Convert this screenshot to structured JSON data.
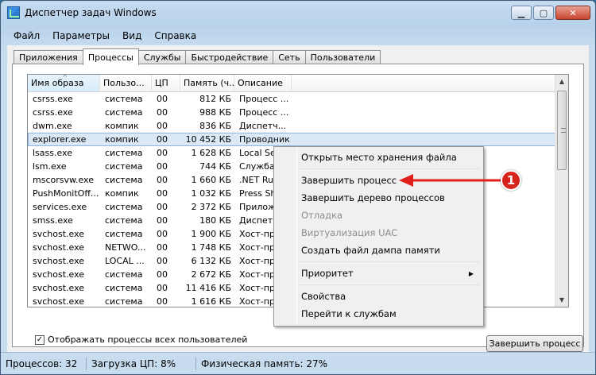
{
  "window": {
    "title": "Диспетчер задач Windows"
  },
  "menu": [
    "Файл",
    "Параметры",
    "Вид",
    "Справка"
  ],
  "tabs": [
    "Приложения",
    "Процессы",
    "Службы",
    "Быстродействие",
    "Сеть",
    "Пользователи"
  ],
  "active_tab": "Процессы",
  "columns": [
    "Имя образа",
    "Пользо...",
    "ЦП",
    "Память (ч...",
    "Описание"
  ],
  "rows": [
    [
      "csrss.exe",
      "система",
      "00",
      "812 КБ",
      "Процесс ..."
    ],
    [
      "csrss.exe",
      "система",
      "00",
      "988 КБ",
      "Процесс ..."
    ],
    [
      "dwm.exe",
      "компик",
      "00",
      "836 КБ",
      "Диспетч..."
    ],
    [
      "explorer.exe",
      "компик",
      "00",
      "10 452 КБ",
      "Проводник"
    ],
    [
      "lsass.exe",
      "система",
      "00",
      "1 628 КБ",
      "Local Sec..."
    ],
    [
      "lsm.exe",
      "система",
      "00",
      "744 КБ",
      "Служба ..."
    ],
    [
      "mscorsvw.exe",
      "система",
      "00",
      "1 660 КБ",
      ".NET Run..."
    ],
    [
      "PushMonitOff...",
      "компик",
      "00",
      "1 032 КБ",
      "Press Shif..."
    ],
    [
      "services.exe",
      "система",
      "00",
      "2 372 КБ",
      "Приложе..."
    ],
    [
      "smss.exe",
      "система",
      "00",
      "180 КБ",
      "Диспетч..."
    ],
    [
      "svchost.exe",
      "система",
      "00",
      "1 900 КБ",
      "Хост-про..."
    ],
    [
      "svchost.exe",
      "NETWO...",
      "00",
      "1 748 КБ",
      "Хост-про..."
    ],
    [
      "svchost.exe",
      "LOCAL ...",
      "00",
      "6 132 КБ",
      "Хост-про..."
    ],
    [
      "svchost.exe",
      "система",
      "00",
      "2 672 КБ",
      "Хост-про..."
    ],
    [
      "svchost.exe",
      "система",
      "00",
      "11 416 КБ",
      "Хост-про..."
    ],
    [
      "svchost.exe",
      "система",
      "00",
      "1 616 КБ",
      "Хост-про..."
    ]
  ],
  "selected_row": 3,
  "show_all_label": "Отображать процессы всех пользователей",
  "end_process_button": "Завершить процесс",
  "status": {
    "processes": "Процессов: 32",
    "cpu": "Загрузка ЦП: 8%",
    "memory": "Физическая память: 27%"
  },
  "context_menu": [
    {
      "label": "Открыть место хранения файла",
      "disabled": false
    },
    {
      "sep": true
    },
    {
      "label": "Завершить процесс",
      "disabled": false
    },
    {
      "label": "Завершить дерево процессов",
      "disabled": false
    },
    {
      "label": "Отладка",
      "disabled": true
    },
    {
      "label": "Виртуализация UAC",
      "disabled": true
    },
    {
      "label": "Создать файл дампа памяти",
      "disabled": false
    },
    {
      "sep": true
    },
    {
      "label": "Приоритет",
      "disabled": false,
      "submenu": true
    },
    {
      "sep": true
    },
    {
      "label": "Свойства",
      "disabled": false
    },
    {
      "label": "Перейти к службам",
      "disabled": false
    }
  ],
  "annotation_number": "1",
  "colors": {
    "arrow": "#e0201c",
    "selection": "#dbe8f6"
  }
}
